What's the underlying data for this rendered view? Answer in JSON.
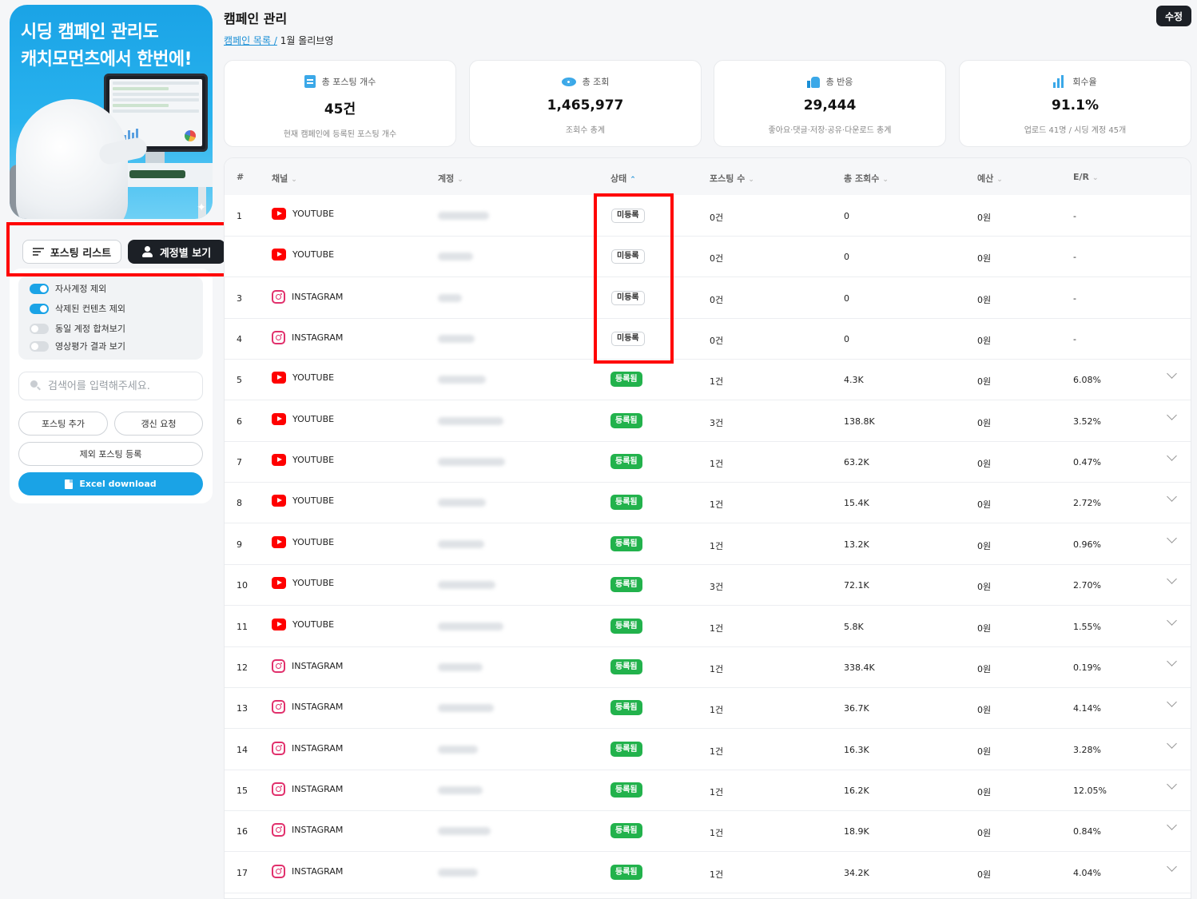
{
  "banner": {
    "line1": "시딩 캠페인 관리도",
    "line2": "캐치모먼츠에서 한번에!"
  },
  "view_toggle": {
    "list_label": "포스팅 리스트",
    "account_label": "계정별 보기"
  },
  "toggles": [
    {
      "label": "자사계정 제외",
      "on": true
    },
    {
      "label": "삭제된 컨텐츠 제외",
      "on": true
    },
    {
      "label": "동일 계정 합쳐보기",
      "on": false
    },
    {
      "label": "영상평가 결과 보기",
      "on": false
    }
  ],
  "search": {
    "placeholder": "검색어를 입력해주세요."
  },
  "buttons": {
    "add_posting": "포스팅 추가",
    "refresh_request": "갱신 요청",
    "exclude_posting": "제외 포스팅 등록",
    "excel": "Excel download"
  },
  "header": {
    "title": "캠페인 관리",
    "breadcrumb_link": "캠페인 목록 /",
    "breadcrumb_current": "1월 올리브영",
    "edit_label": "수정"
  },
  "stats": [
    {
      "icon": "list-icon",
      "label": "총 포스팅 개수",
      "value": "45건",
      "sub": "현재 캠페인에 등록된 포스팅 개수"
    },
    {
      "icon": "eye-icon",
      "label": "총 조회",
      "value": "1,465,977",
      "sub": "조회수 총계"
    },
    {
      "icon": "thumbs-up-icon",
      "label": "총 반응",
      "value": "29,444",
      "sub": "좋아요·댓글·저장·공유·다운로드 총계"
    },
    {
      "icon": "bar-chart-icon",
      "label": "회수율",
      "value": "91.1%",
      "sub": "업로드 41명 / 시딩 계정 45개"
    }
  ],
  "table": {
    "columns": [
      "#",
      "채널",
      "계정",
      "상태",
      "포스팅 수",
      "총 조회수",
      "예산",
      "E/R"
    ],
    "rows": [
      {
        "num": "1",
        "channel": "YOUTUBE",
        "status": "미등록",
        "posts": "0건",
        "views": "0",
        "budget": "0원",
        "er": "-"
      },
      {
        "num": "",
        "channel": "YOUTUBE",
        "status": "미등록",
        "posts": "0건",
        "views": "0",
        "budget": "0원",
        "er": "-"
      },
      {
        "num": "3",
        "channel": "INSTAGRAM",
        "status": "미등록",
        "posts": "0건",
        "views": "0",
        "budget": "0원",
        "er": "-"
      },
      {
        "num": "4",
        "channel": "INSTAGRAM",
        "status": "미등록",
        "posts": "0건",
        "views": "0",
        "budget": "0원",
        "er": "-"
      },
      {
        "num": "5",
        "channel": "YOUTUBE",
        "status": "등록됨",
        "posts": "1건",
        "views": "4.3K",
        "budget": "0원",
        "er": "6.08%"
      },
      {
        "num": "6",
        "channel": "YOUTUBE",
        "status": "등록됨",
        "posts": "3건",
        "views": "138.8K",
        "budget": "0원",
        "er": "3.52%"
      },
      {
        "num": "7",
        "channel": "YOUTUBE",
        "status": "등록됨",
        "posts": "1건",
        "views": "63.2K",
        "budget": "0원",
        "er": "0.47%"
      },
      {
        "num": "8",
        "channel": "YOUTUBE",
        "status": "등록됨",
        "posts": "1건",
        "views": "15.4K",
        "budget": "0원",
        "er": "2.72%"
      },
      {
        "num": "9",
        "channel": "YOUTUBE",
        "status": "등록됨",
        "posts": "1건",
        "views": "13.2K",
        "budget": "0원",
        "er": "0.96%"
      },
      {
        "num": "10",
        "channel": "YOUTUBE",
        "status": "등록됨",
        "posts": "3건",
        "views": "72.1K",
        "budget": "0원",
        "er": "2.70%"
      },
      {
        "num": "11",
        "channel": "YOUTUBE",
        "status": "등록됨",
        "posts": "1건",
        "views": "5.8K",
        "budget": "0원",
        "er": "1.55%"
      },
      {
        "num": "12",
        "channel": "INSTAGRAM",
        "status": "등록됨",
        "posts": "1건",
        "views": "338.4K",
        "budget": "0원",
        "er": "0.19%"
      },
      {
        "num": "13",
        "channel": "INSTAGRAM",
        "status": "등록됨",
        "posts": "1건",
        "views": "36.7K",
        "budget": "0원",
        "er": "4.14%"
      },
      {
        "num": "14",
        "channel": "INSTAGRAM",
        "status": "등록됨",
        "posts": "1건",
        "views": "16.3K",
        "budget": "0원",
        "er": "3.28%"
      },
      {
        "num": "15",
        "channel": "INSTAGRAM",
        "status": "등록됨",
        "posts": "1건",
        "views": "16.2K",
        "budget": "0원",
        "er": "12.05%"
      },
      {
        "num": "16",
        "channel": "INSTAGRAM",
        "status": "등록됨",
        "posts": "1건",
        "views": "18.9K",
        "budget": "0원",
        "er": "0.84%"
      },
      {
        "num": "17",
        "channel": "INSTAGRAM",
        "status": "등록됨",
        "posts": "1건",
        "views": "34.2K",
        "budget": "0원",
        "er": "4.04%"
      }
    ]
  },
  "colors": {
    "accent": "#1aa3e6",
    "registered": "#22b24c",
    "highlight_box": "#ff0000",
    "youtube": "#ff0000",
    "instagram": "#e1306c"
  }
}
